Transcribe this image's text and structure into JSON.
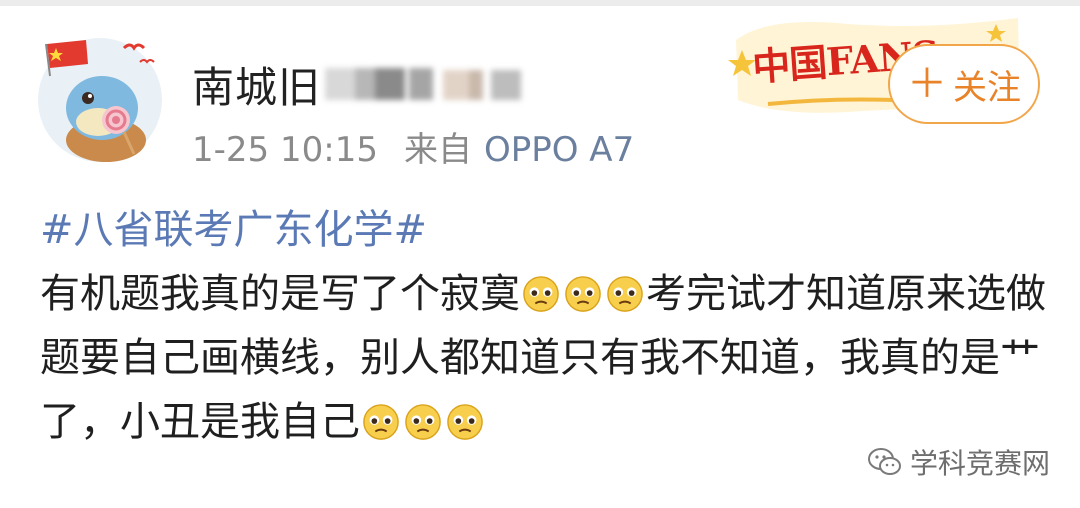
{
  "post": {
    "username": "南城旧",
    "time": "1-25 10:15",
    "source_label": "来自",
    "device": "OPPO A7",
    "follow_label": "关注",
    "follow_plus": "＋",
    "fans_badge_text": "中国FANS",
    "hashtag": "#八省联考广东化学#",
    "text_part1": "有机题我真的是写了个寂寞",
    "text_part2": "考完试才知道原来选做题要自己画横线，别人都知道只有我不知道，我真的是艹了，小丑是我自己"
  },
  "watermark": {
    "text": "学科竞赛网"
  },
  "icons": {
    "avatar": "squirtle-with-lollipop-avatar",
    "flag": "china-flag-icon",
    "emoji": "pleading-face-icon",
    "watermark_logo": "wechat-icon"
  },
  "colors": {
    "hashtag": "#5b7ab5",
    "follow": "#e8832a",
    "fans_red": "#d9261c",
    "meta_gray": "#8a8a8a"
  }
}
